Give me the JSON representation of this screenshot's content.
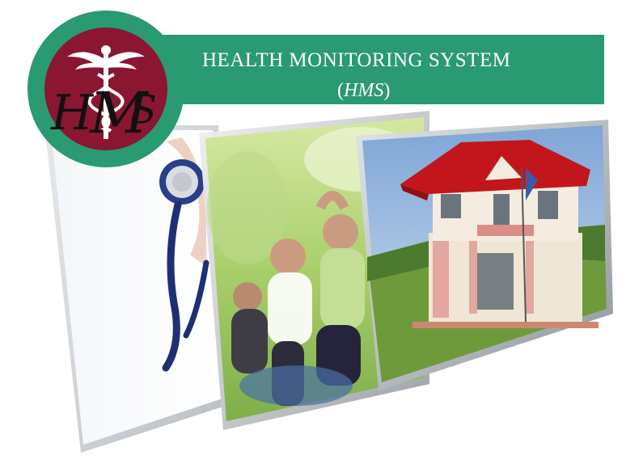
{
  "banner": {
    "title": "HEALTH MONITORING SYSTEM",
    "subtitle_open": "(",
    "subtitle_abbr": "HMS",
    "subtitle_close": ")",
    "color": "#2a9a72"
  },
  "logo": {
    "text": "HMS",
    "ring_color": "#2a9a72",
    "disc_color": "#8a1632",
    "icon": "caduceus-icon"
  },
  "panels": [
    {
      "name": "stethoscope-photo",
      "depicts": "stethoscope"
    },
    {
      "name": "exercise-photo",
      "depicts": "people stretching outdoors"
    },
    {
      "name": "health-center-photo",
      "depicts": "two-storey building with red roof"
    }
  ]
}
